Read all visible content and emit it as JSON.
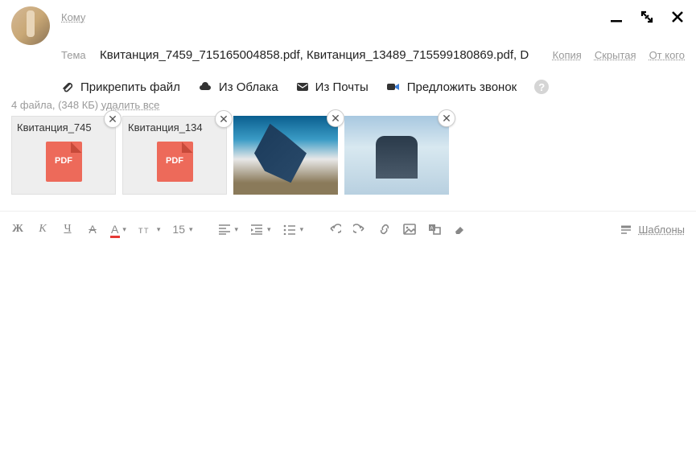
{
  "header": {
    "to_label": "Кому"
  },
  "subject": {
    "label": "Тема",
    "value": "Квитанция_7459_715165004858.pdf, Квитанция_13489_715599180869.pdf, D",
    "links": {
      "copy": "Копия",
      "bcc": "Скрытая",
      "from": "От кого"
    }
  },
  "attach": {
    "file": "Прикрепить файл",
    "cloud": "Из Облака",
    "mail": "Из Почты",
    "call": "Предложить звонок"
  },
  "files": {
    "summary_count": "4 файла, (348 КБ) ",
    "delete_all": "удалить все",
    "items": [
      {
        "name": "Квитанция_745",
        "type": "pdf"
      },
      {
        "name": "Квитанция_134",
        "type": "pdf"
      },
      {
        "name": "",
        "type": "image"
      },
      {
        "name": "",
        "type": "image"
      }
    ]
  },
  "toolbar": {
    "font_size": "15",
    "templates": "Шаблоны"
  }
}
